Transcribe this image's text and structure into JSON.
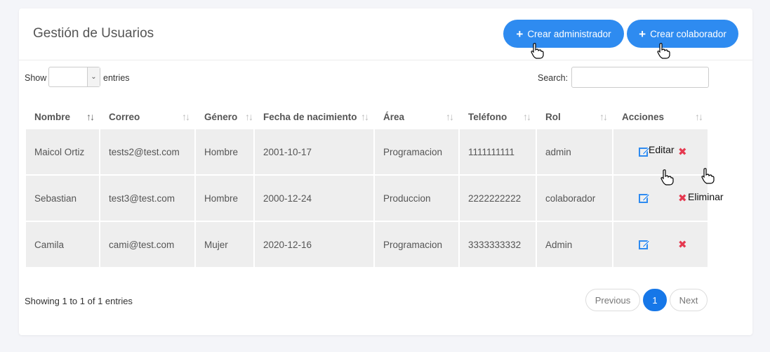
{
  "header": {
    "title": "Gestión de Usuarios",
    "create_admin_label": "Crear administrador",
    "create_colab_label": "Crear colaborador",
    "plus": "+",
    "accent_color": "#2e8bf0"
  },
  "controls": {
    "show_label": "Show",
    "entries_label": "entries",
    "entries_value": "",
    "search_label": "Search:",
    "search_value": ""
  },
  "table": {
    "columns": [
      "Nombre",
      "Correo",
      "Género",
      "Fecha de nacimiento",
      "Área",
      "Teléfono",
      "Rol",
      "Acciones"
    ],
    "sort_glyph": "↑↓",
    "rows": [
      {
        "nombre": "Maicol Ortiz",
        "correo": "tests2@test.com",
        "genero": "Hombre",
        "fecha": "2001-10-17",
        "area": "Programacion",
        "telefono": "1111111111",
        "rol": "admin"
      },
      {
        "nombre": "Sebastian",
        "correo": "test3@test.com",
        "genero": "Hombre",
        "fecha": "2000-12-24",
        "area": "Produccion",
        "telefono": "2222222222",
        "rol": "colaborador"
      },
      {
        "nombre": "Camila",
        "correo": "cami@test.com",
        "genero": "Mujer",
        "fecha": "2020-12-16",
        "area": "Programacion",
        "telefono": "3333333332",
        "rol": "Admin"
      }
    ],
    "edit_icon": "edit-icon",
    "delete_glyph": "✖",
    "delete_color": "#e53950"
  },
  "tooltips": {
    "edit": "Editar",
    "delete": "Eliminar"
  },
  "footer": {
    "info": "Showing 1 to 1 of 1 entries",
    "previous": "Previous",
    "page": "1",
    "next": "Next"
  }
}
